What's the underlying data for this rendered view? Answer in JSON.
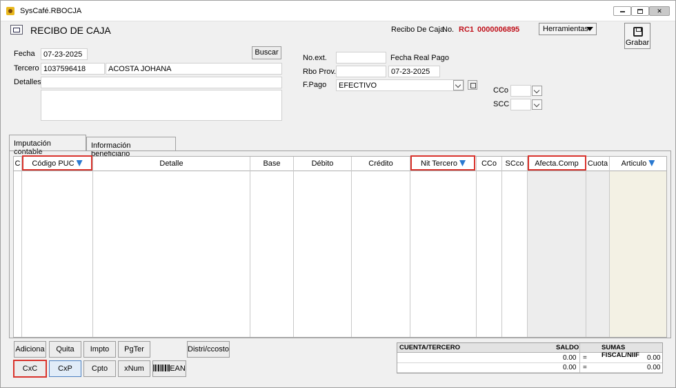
{
  "window": {
    "title": "SysCafé.RBOCJA"
  },
  "header": {
    "title": "RECIBO DE CAJA",
    "receipt_label": "Recibo De Caja",
    "no_label": "No.",
    "receipt_code": "RC1",
    "receipt_number": "0000006895",
    "tools_label": "Herramientas",
    "save_label": "Grabar"
  },
  "form": {
    "fecha_label": "Fecha",
    "fecha_value": "07-23-2025",
    "buscar_label": "Buscar",
    "tercero_label": "Tercero",
    "tercero_id": "1037596418",
    "tercero_name": "ACOSTA JOHANA",
    "detalles_label": "Detalles",
    "detalles_value": "",
    "noext_label": "No.ext.",
    "noext_value": "",
    "fecha_real_label": "Fecha Real Pago",
    "rbo_prov_label": "Rbo Prov.",
    "rbo_prov_value": "",
    "fecha_real_value": "07-23-2025",
    "fpago_label": "F.Pago",
    "fpago_value": "EFECTIVO",
    "cco_label": "CCo",
    "scc_label": "SCC"
  },
  "tabs": [
    "Imputación contable",
    "Información beneficiario"
  ],
  "table": {
    "columns": [
      "C",
      "Código PUC",
      "Detalle",
      "Base",
      "Débito",
      "Crédito",
      "Nit Tercero",
      "CCo",
      "SCco",
      "Afecta.Comp",
      "Cuota",
      "Articulo"
    ],
    "rows": []
  },
  "buttons": {
    "adiciona": "Adiciona",
    "quita": "Quita",
    "impto": "Impto",
    "pgter": "PgTer",
    "distri": "Distri/ccosto",
    "cxc": "CxC",
    "cxp": "CxP",
    "cpto": "Cpto",
    "xnum": "xNum",
    "ean": "EAN"
  },
  "summary": {
    "col_account": "CUENTA/TERCERO",
    "col_balance": "SALDO",
    "col_sums": "SUMAS FISCAL/NIIF",
    "rows": [
      {
        "saldo": "0.00",
        "eq": "=",
        "suma": "0.00"
      },
      {
        "saldo": "0.00",
        "eq": "=",
        "suma": "0.00"
      }
    ]
  },
  "colors": {
    "highlight": "#d9322b",
    "receipt_red": "#c0101a",
    "sort_icon": "#2a79d0"
  }
}
